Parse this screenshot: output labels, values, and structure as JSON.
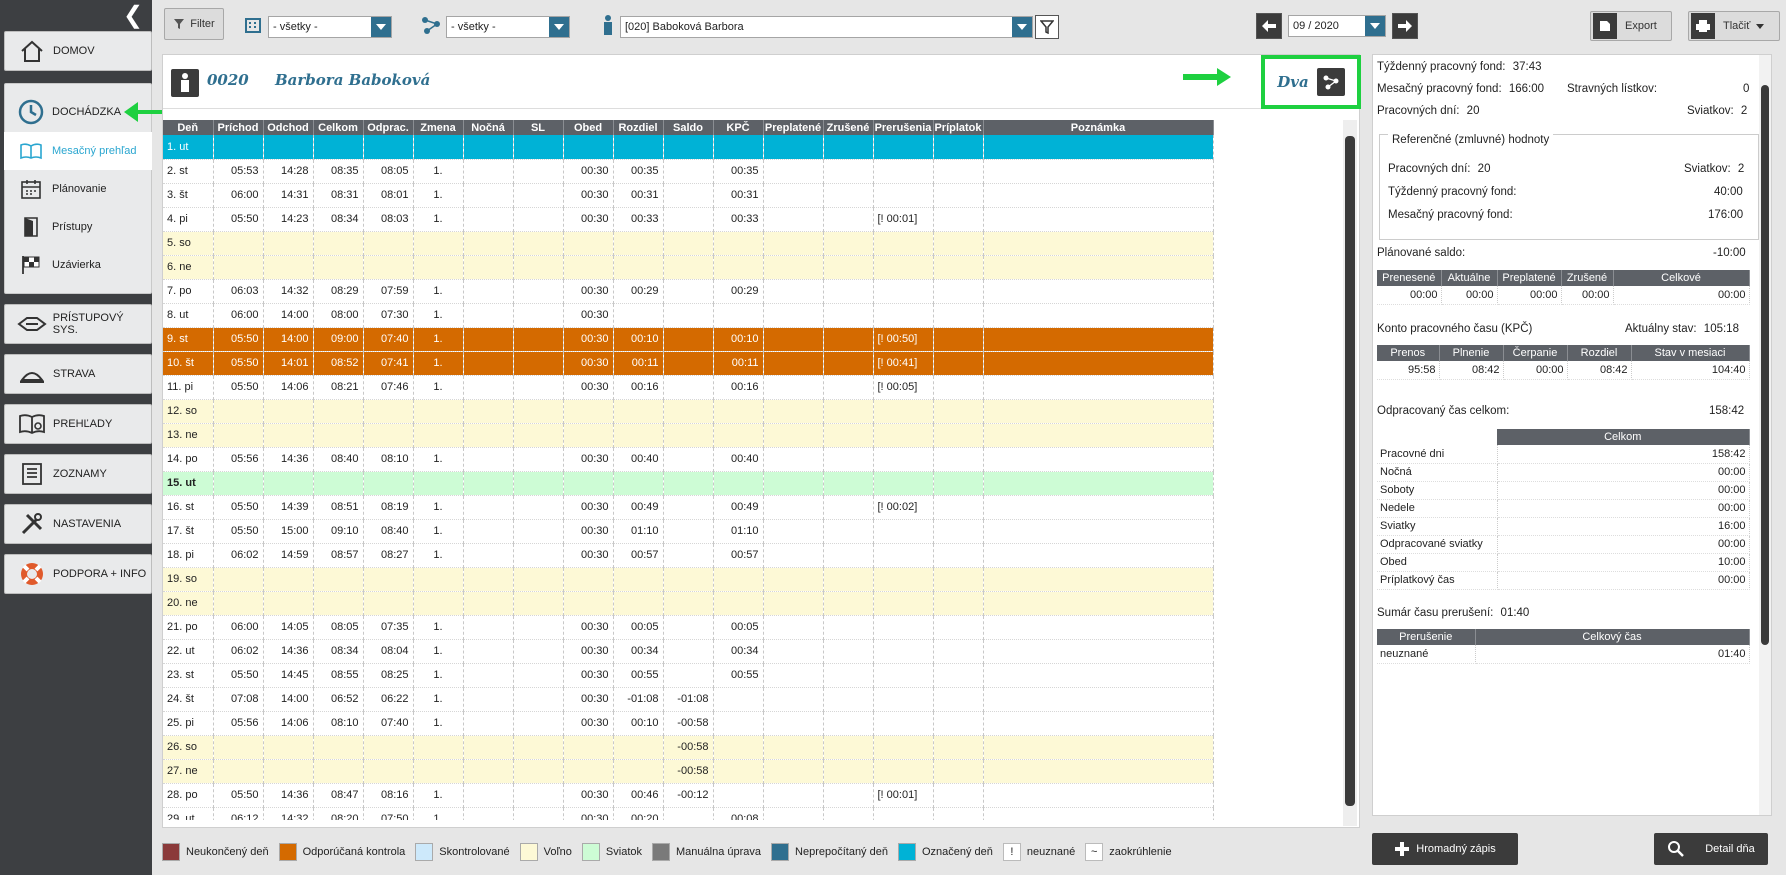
{
  "sidebar": {
    "main_items": [
      {
        "label": "DOMOV"
      },
      {
        "label": "DOCHÁDZKA"
      },
      {
        "label": "PRÍSTUPOVÝ SYS."
      },
      {
        "label": "STRAVA"
      },
      {
        "label": "PREHĽADY"
      },
      {
        "label": "ZOZNAMY"
      },
      {
        "label": "NASTAVENIA"
      },
      {
        "label": "PODPORA + INFO"
      }
    ],
    "sub_items": [
      {
        "label": "Mesačný prehľad"
      },
      {
        "label": "Plánovanie"
      },
      {
        "label": "Prístupy"
      },
      {
        "label": "Uzávierka"
      }
    ]
  },
  "toolbar": {
    "filter_label": "Filter",
    "filter1_value": "- všetky -",
    "filter2_value": "- všetky -",
    "employee_value": "[020] Baboková Barbora",
    "period_value": "09 / 2020",
    "export_label": "Export",
    "print_label": "Tlačiť"
  },
  "employee": {
    "number": "0020",
    "name": "Barbora Baboková",
    "group": "Dva"
  },
  "table": {
    "headers": [
      "Deň",
      "Príchod",
      "Odchod",
      "Celkom",
      "Odprac.",
      "Zmena",
      "Nočná",
      "SL",
      "Obed",
      "Rozdiel",
      "Saldo",
      "KPČ",
      "Preplatené",
      "Zrušené",
      "Prerušenia",
      "Príplatok",
      "Poznámka"
    ],
    "rows": [
      {
        "type": "marked",
        "cells": [
          "1. ut",
          "",
          "",
          "",
          "",
          "",
          "",
          "",
          "",
          "",
          "",
          "",
          "",
          "",
          "",
          "",
          ""
        ]
      },
      {
        "type": "",
        "cells": [
          "2. st",
          "05:53",
          "14:28",
          "08:35",
          "08:05",
          "1.",
          "",
          "",
          "00:30",
          "00:35",
          "",
          "00:35",
          "",
          "",
          "",
          "",
          ""
        ]
      },
      {
        "type": "",
        "cells": [
          "3. št",
          "06:00",
          "14:31",
          "08:31",
          "08:01",
          "1.",
          "",
          "",
          "00:30",
          "00:31",
          "",
          "00:31",
          "",
          "",
          "",
          "",
          ""
        ]
      },
      {
        "type": "",
        "cells": [
          "4. pi",
          "05:50",
          "14:23",
          "08:34",
          "08:03",
          "1.",
          "",
          "",
          "00:30",
          "00:33",
          "",
          "00:33",
          "",
          "",
          "[! 00:01]",
          "",
          ""
        ]
      },
      {
        "type": "weekend",
        "cells": [
          "5. so",
          "",
          "",
          "",
          "",
          "",
          "",
          "",
          "",
          "",
          "",
          "",
          "",
          "",
          "",
          "",
          ""
        ]
      },
      {
        "type": "weekend",
        "cells": [
          "6. ne",
          "",
          "",
          "",
          "",
          "",
          "",
          "",
          "",
          "",
          "",
          "",
          "",
          "",
          "",
          "",
          ""
        ]
      },
      {
        "type": "",
        "cells": [
          "7. po",
          "06:03",
          "14:32",
          "08:29",
          "07:59",
          "1.",
          "",
          "",
          "00:30",
          "00:29",
          "",
          "00:29",
          "",
          "",
          "",
          "",
          ""
        ]
      },
      {
        "type": "",
        "cells": [
          "8. ut",
          "06:00",
          "14:00",
          "08:00",
          "07:30",
          "1.",
          "",
          "",
          "00:30",
          "",
          "",
          "",
          "",
          "",
          "",
          "",
          ""
        ]
      },
      {
        "type": "orange",
        "cells": [
          "9. st",
          "05:50",
          "14:00",
          "09:00",
          "07:40",
          "1.",
          "",
          "",
          "00:30",
          "00:10",
          "",
          "00:10",
          "",
          "",
          "[! 00:50]",
          "",
          ""
        ]
      },
      {
        "type": "orange",
        "cells": [
          "10. št",
          "05:50",
          "14:01",
          "08:52",
          "07:41",
          "1.",
          "",
          "",
          "00:30",
          "00:11",
          "",
          "00:11",
          "",
          "",
          "[! 00:41]",
          "",
          ""
        ]
      },
      {
        "type": "",
        "cells": [
          "11. pi",
          "05:50",
          "14:06",
          "08:21",
          "07:46",
          "1.",
          "",
          "",
          "00:30",
          "00:16",
          "",
          "00:16",
          "",
          "",
          "[! 00:05]",
          "",
          ""
        ]
      },
      {
        "type": "weekend",
        "cells": [
          "12. so",
          "",
          "",
          "",
          "",
          "",
          "",
          "",
          "",
          "",
          "",
          "",
          "",
          "",
          "",
          "",
          ""
        ]
      },
      {
        "type": "weekend",
        "cells": [
          "13. ne",
          "",
          "",
          "",
          "",
          "",
          "",
          "",
          "",
          "",
          "",
          "",
          "",
          "",
          "",
          "",
          ""
        ]
      },
      {
        "type": "",
        "cells": [
          "14. po",
          "05:56",
          "14:36",
          "08:40",
          "08:10",
          "1.",
          "",
          "",
          "00:30",
          "00:40",
          "",
          "00:40",
          "",
          "",
          "",
          "",
          ""
        ]
      },
      {
        "type": "holiday",
        "cells": [
          "15. ut",
          "",
          "",
          "",
          "",
          "",
          "",
          "",
          "",
          "",
          "",
          "",
          "",
          "",
          "",
          "",
          ""
        ]
      },
      {
        "type": "",
        "cells": [
          "16. st",
          "05:50",
          "14:39",
          "08:51",
          "08:19",
          "1.",
          "",
          "",
          "00:30",
          "00:49",
          "",
          "00:49",
          "",
          "",
          "[! 00:02]",
          "",
          ""
        ]
      },
      {
        "type": "",
        "cells": [
          "17. št",
          "05:50",
          "15:00",
          "09:10",
          "08:40",
          "1.",
          "",
          "",
          "00:30",
          "01:10",
          "",
          "01:10",
          "",
          "",
          "",
          "",
          ""
        ]
      },
      {
        "type": "",
        "cells": [
          "18. pi",
          "06:02",
          "14:59",
          "08:57",
          "08:27",
          "1.",
          "",
          "",
          "00:30",
          "00:57",
          "",
          "00:57",
          "",
          "",
          "",
          "",
          ""
        ]
      },
      {
        "type": "weekend",
        "cells": [
          "19. so",
          "",
          "",
          "",
          "",
          "",
          "",
          "",
          "",
          "",
          "",
          "",
          "",
          "",
          "",
          "",
          ""
        ]
      },
      {
        "type": "weekend",
        "cells": [
          "20. ne",
          "",
          "",
          "",
          "",
          "",
          "",
          "",
          "",
          "",
          "",
          "",
          "",
          "",
          "",
          "",
          ""
        ]
      },
      {
        "type": "",
        "cells": [
          "21. po",
          "06:00",
          "14:05",
          "08:05",
          "07:35",
          "1.",
          "",
          "",
          "00:30",
          "00:05",
          "",
          "00:05",
          "",
          "",
          "",
          "",
          ""
        ]
      },
      {
        "type": "",
        "cells": [
          "22. ut",
          "06:02",
          "14:36",
          "08:34",
          "08:04",
          "1.",
          "",
          "",
          "00:30",
          "00:34",
          "",
          "00:34",
          "",
          "",
          "",
          "",
          ""
        ]
      },
      {
        "type": "",
        "cells": [
          "23. st",
          "05:50",
          "14:45",
          "08:55",
          "08:25",
          "1.",
          "",
          "",
          "00:30",
          "00:55",
          "",
          "00:55",
          "",
          "",
          "",
          "",
          ""
        ]
      },
      {
        "type": "",
        "cells": [
          "24. št",
          "07:08",
          "14:00",
          "06:52",
          "06:22",
          "1.",
          "",
          "",
          "00:30",
          "-01:08",
          "-01:08",
          "",
          "",
          "",
          "",
          "",
          ""
        ]
      },
      {
        "type": "",
        "cells": [
          "25. pi",
          "05:56",
          "14:06",
          "08:10",
          "07:40",
          "1.",
          "",
          "",
          "00:30",
          "00:10",
          "-00:58",
          "",
          "",
          "",
          "",
          "",
          ""
        ]
      },
      {
        "type": "weekend",
        "cells": [
          "26. so",
          "",
          "",
          "",
          "",
          "",
          "",
          "",
          "",
          "",
          "-00:58",
          "",
          "",
          "",
          "",
          "",
          ""
        ]
      },
      {
        "type": "weekend",
        "cells": [
          "27. ne",
          "",
          "",
          "",
          "",
          "",
          "",
          "",
          "",
          "",
          "-00:58",
          "",
          "",
          "",
          "",
          "",
          ""
        ]
      },
      {
        "type": "",
        "cells": [
          "28. po",
          "05:50",
          "14:36",
          "08:47",
          "08:16",
          "1.",
          "",
          "",
          "00:30",
          "00:46",
          "-00:12",
          "",
          "",
          "",
          "[! 00:01]",
          "",
          ""
        ]
      },
      {
        "type": "",
        "cells": [
          "29. ut",
          "06:12",
          "14:32",
          "08:20",
          "07:50",
          "1.",
          "",
          "",
          "00:30",
          "00:20",
          "",
          "00:08",
          "",
          "",
          "",
          "",
          ""
        ]
      }
    ]
  },
  "legend": [
    {
      "label": "Neukončený deň",
      "color": "#8b3a3a"
    },
    {
      "label": "Odporúčaná kontrola",
      "color": "#d46a00"
    },
    {
      "label": "Skontrolované",
      "color": "#cde9fb"
    },
    {
      "label": "Voľno",
      "color": "#fdf9d6"
    },
    {
      "label": "Sviatok",
      "color": "#cdfcd5"
    },
    {
      "label": "Manuálna úprava",
      "color": "#7a7a7a"
    },
    {
      "label": "Neprepočítaný deň",
      "color": "#2f6f8f"
    },
    {
      "label": "Označený deň",
      "color": "#00b2d6"
    }
  ],
  "legend_symbols": [
    {
      "symbol": "!",
      "label": "neuznané"
    },
    {
      "symbol": "~",
      "label": "zaokrúhlenie"
    }
  ],
  "summary": {
    "weekly_fund_label": "Týždenný pracovný fond:",
    "weekly_fund": "37:43",
    "monthly_fund_label": "Mesačný pracovný fond:",
    "monthly_fund": "166:00",
    "meal_label": "Stravných lístkov:",
    "meal": "0",
    "workdays_label": "Pracovných dní:",
    "workdays": "20",
    "holidays_label": "Sviatkov:",
    "holidays": "2",
    "ref_title": "Referenčné (zmluvné) hodnoty",
    "ref_workdays_label": "Pracovných dní:",
    "ref_workdays": "20",
    "ref_holidays_label": "Sviatkov:",
    "ref_holidays": "2",
    "ref_weekly_label": "Týždenný pracovný fond:",
    "ref_weekly": "40:00",
    "ref_monthly_label": "Mesačný pracovný fond:",
    "ref_monthly": "176:00",
    "plan_saldo_label": "Plánované saldo:",
    "plan_saldo": "-10:00",
    "saldo_headers": [
      "Prenesené",
      "Aktuálne",
      "Preplatené",
      "Zrušené",
      "Celkové"
    ],
    "saldo_values": [
      "00:00",
      "00:00",
      "00:00",
      "00:00",
      "00:00"
    ],
    "kpc_label": "Konto pracovného času (KPČ)",
    "kpc_state_label": "Aktuálny stav:",
    "kpc_state": "105:18",
    "kpc_headers": [
      "Prenos",
      "Plnenie",
      "Čerpanie",
      "Rozdiel",
      "Stav v mesiaci"
    ],
    "kpc_values": [
      "95:58",
      "08:42",
      "00:00",
      "08:42",
      "104:40"
    ],
    "worked_label": "Odpracovaný čas celkom:",
    "worked": "158:42",
    "worked_header": "Celkom",
    "worked_rows": [
      {
        "label": "Pracovné dni",
        "value": "158:42"
      },
      {
        "label": "Nočná",
        "value": "00:00"
      },
      {
        "label": "Soboty",
        "value": "00:00"
      },
      {
        "label": "Nedele",
        "value": "00:00"
      },
      {
        "label": "Sviatky",
        "value": "16:00"
      },
      {
        "label": "Odpracované sviatky",
        "value": "00:00"
      },
      {
        "label": "Obed",
        "value": "10:00"
      },
      {
        "label": "Príplatkový čas",
        "value": "00:00"
      }
    ],
    "breaks_label": "Sumár času prerušení:",
    "breaks": "01:40",
    "breaks_headers": [
      "Prerušenie",
      "Celkový čas"
    ],
    "breaks_rows": [
      {
        "label": "neuznané",
        "value": "01:40"
      }
    ]
  },
  "bottom": {
    "bulk_label": "Hromadný zápis",
    "detail_label": "Detail dňa"
  }
}
